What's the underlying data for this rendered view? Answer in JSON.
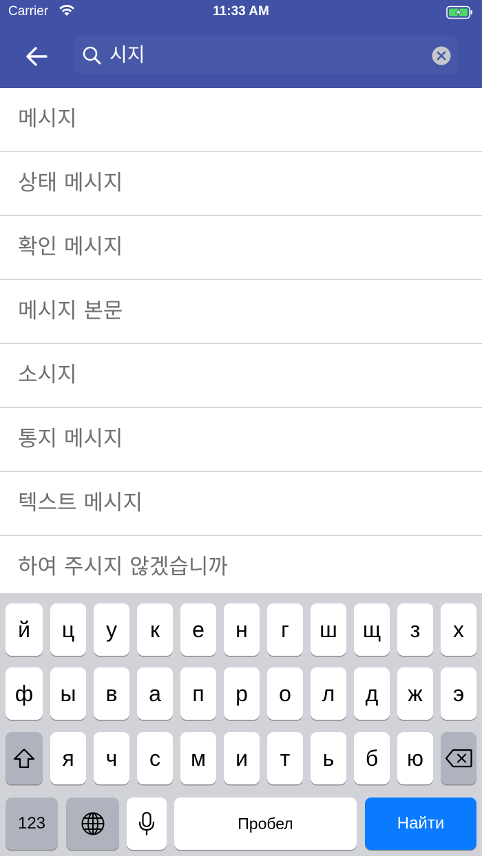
{
  "status_bar": {
    "carrier": "Carrier",
    "time": "11:33 AM"
  },
  "search": {
    "value": "시지",
    "icons": [
      "back-arrow-icon",
      "search-icon",
      "clear-icon"
    ]
  },
  "results": [
    "메시지",
    "상태 메시지",
    "확인 메시지",
    "메시지 본문",
    "소시지",
    "통지 메시지",
    "텍스트 메시지",
    "하여 주시지 않겠습니까"
  ],
  "keyboard": {
    "row1": [
      "й",
      "ц",
      "у",
      "к",
      "е",
      "н",
      "г",
      "ш",
      "щ",
      "з",
      "х"
    ],
    "row2": [
      "ф",
      "ы",
      "в",
      "а",
      "п",
      "р",
      "о",
      "л",
      "д",
      "ж",
      "э"
    ],
    "row3": [
      "я",
      "ч",
      "с",
      "м",
      "и",
      "т",
      "ь",
      "б",
      "ю"
    ],
    "numbers_label": "123",
    "space_label": "Пробел",
    "action_label": "Найти",
    "icons": [
      "shift-icon",
      "backspace-icon",
      "globe-icon",
      "microphone-icon"
    ]
  },
  "colors": {
    "header": "#4152a6",
    "keyboard_bg": "#d1d3d9",
    "action_key": "#0a7aff",
    "result_text": "#6e6e6e"
  }
}
